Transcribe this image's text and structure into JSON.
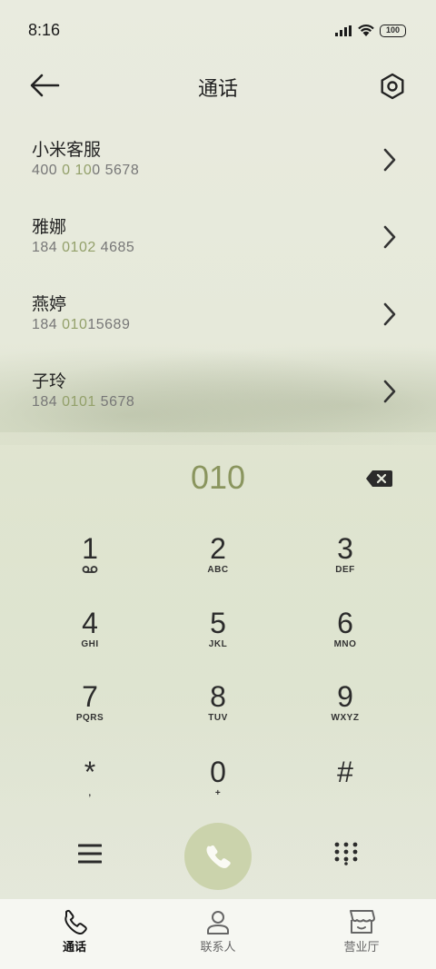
{
  "status": {
    "time": "8:16",
    "battery": "100"
  },
  "header": {
    "title": "通话"
  },
  "contacts": [
    {
      "name": "小米客服",
      "pre": "400 ",
      "hl": "0 10",
      "post": "0 5678"
    },
    {
      "name": "雅娜",
      "pre": "184 ",
      "hl": "0102",
      "post": " 4685"
    },
    {
      "name": "燕婷",
      "pre": "184 ",
      "hl": "010",
      "post": "15689"
    },
    {
      "name": "子玲",
      "pre": "184 ",
      "hl": "0101",
      "post": " 5678"
    }
  ],
  "dialer": {
    "input": "010",
    "keys": [
      {
        "digit": "1",
        "letters": ""
      },
      {
        "digit": "2",
        "letters": "ABC"
      },
      {
        "digit": "3",
        "letters": "DEF"
      },
      {
        "digit": "4",
        "letters": "GHI"
      },
      {
        "digit": "5",
        "letters": "JKL"
      },
      {
        "digit": "6",
        "letters": "MNO"
      },
      {
        "digit": "7",
        "letters": "PQRS"
      },
      {
        "digit": "8",
        "letters": "TUV"
      },
      {
        "digit": "9",
        "letters": "WXYZ"
      },
      {
        "digit": "*",
        "letters": ","
      },
      {
        "digit": "0",
        "letters": "+"
      },
      {
        "digit": "#",
        "letters": ""
      }
    ]
  },
  "tabs": [
    {
      "label": "通话",
      "icon": "phone-icon"
    },
    {
      "label": "联系人",
      "icon": "person-icon"
    },
    {
      "label": "营业厅",
      "icon": "store-icon"
    }
  ],
  "colors": {
    "accent": "#93a06a",
    "call_button": "#cbd3ac"
  }
}
